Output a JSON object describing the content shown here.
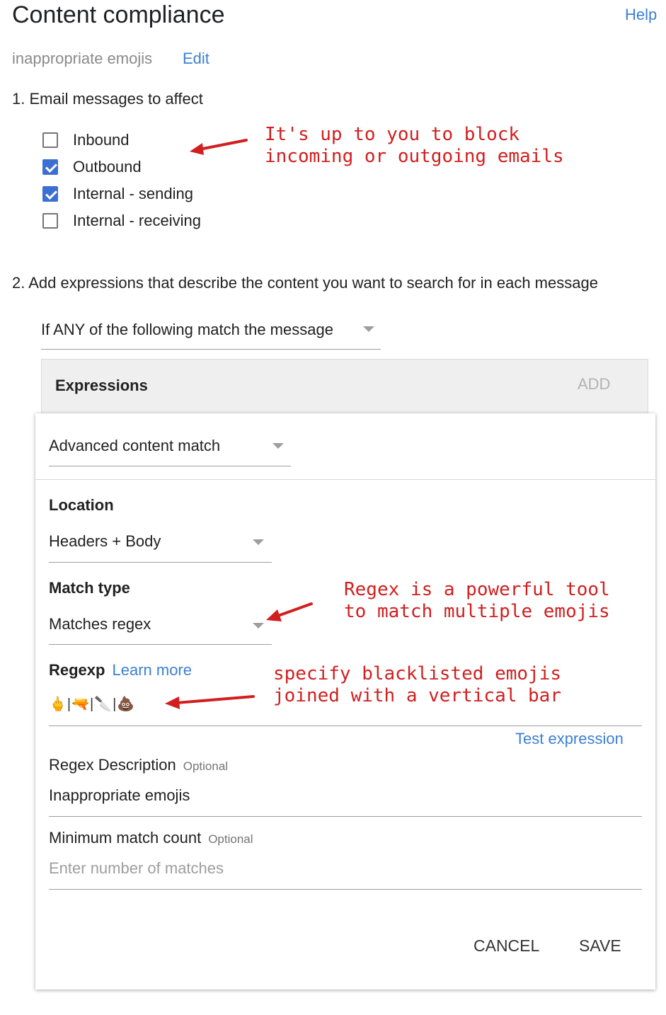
{
  "header": {
    "title": "Content compliance",
    "help_label": "Help",
    "rule_name": "inappropriate emojis",
    "edit_label": "Edit"
  },
  "section1": {
    "heading": "1. Email messages to affect",
    "options": [
      {
        "label": "Inbound",
        "checked": false
      },
      {
        "label": "Outbound",
        "checked": true
      },
      {
        "label": "Internal - sending",
        "checked": true
      },
      {
        "label": "Internal - receiving",
        "checked": false
      }
    ]
  },
  "section2": {
    "heading": "2. Add expressions that describe the content you want to search for in each message",
    "condition_value": "If ANY of the following match the message",
    "expressions_title": "Expressions",
    "add_label": "ADD"
  },
  "expression": {
    "type_value": "Advanced content match",
    "location_label": "Location",
    "location_value": "Headers + Body",
    "match_type_label": "Match type",
    "match_type_value": "Matches regex",
    "regexp_label": "Regexp",
    "learn_more_label": "Learn more",
    "regexp_value": "🖕|🔫|🔪|💩",
    "test_expression_label": "Test expression",
    "description_label": "Regex Description",
    "description_optional": "Optional",
    "description_value": "Inappropriate emojis",
    "min_count_label": "Minimum match count",
    "min_count_optional": "Optional",
    "min_count_placeholder": "Enter number of matches",
    "cancel_label": "CANCEL",
    "save_label": "SAVE"
  },
  "annotations": {
    "note1_line1": "It's up to you to block",
    "note1_line2": "incoming or outgoing emails",
    "note2_line1": "Regex is a powerful tool",
    "note2_line2": "to match multiple emojis",
    "note3_line1": "specify blacklisted emojis",
    "note3_line2": "joined with a vertical bar"
  },
  "colors": {
    "accent": "#3c7fd2",
    "checkbox_checked": "#3c6fd2",
    "annotation": "#d11f1f"
  }
}
